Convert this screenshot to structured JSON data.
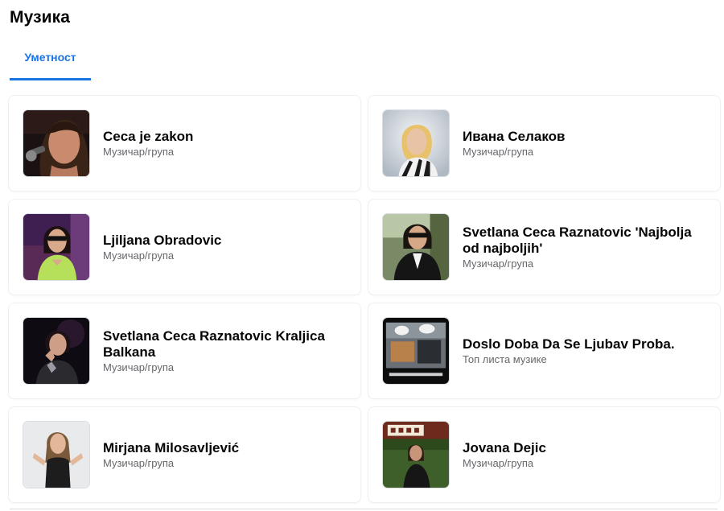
{
  "page": {
    "title": "Музика"
  },
  "tabs": [
    {
      "label": "Уметност",
      "active": true
    }
  ],
  "colors": {
    "accent": "#1b74e4",
    "text": "#050505",
    "secondary_text": "#65676b",
    "divider": "#dadde1"
  },
  "items": [
    {
      "name": "Ceca je zakon",
      "category": "Музичар/група"
    },
    {
      "name": "Ивана Селаков",
      "category": "Музичар/група"
    },
    {
      "name": "Ljiljana Obradovic",
      "category": "Музичар/група"
    },
    {
      "name": "Svetlana Ceca Raznatovic 'Najbolja od najboljih'",
      "category": "Музичар/група"
    },
    {
      "name": "Svetlana Ceca Raznatovic Kraljica Balkana",
      "category": "Музичар/група"
    },
    {
      "name": "Doslo Doba Da Se Ljubav Proba.",
      "category": "Топ листа музике"
    },
    {
      "name": "Mirjana Milosavljević",
      "category": "Музичар/група"
    },
    {
      "name": "Jovana Dejic",
      "category": "Музичар/група"
    }
  ]
}
